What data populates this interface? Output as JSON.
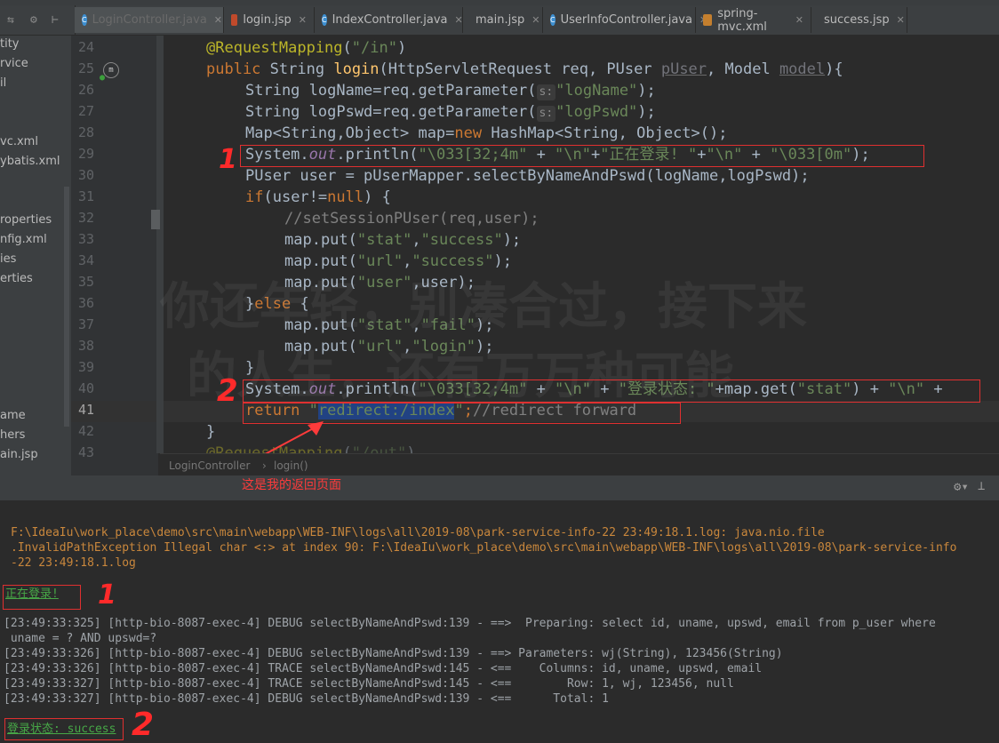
{
  "tabs": [
    {
      "label": "LoginController.java",
      "type": "java",
      "active": true
    },
    {
      "label": "login.jsp",
      "type": "jsp"
    },
    {
      "label": "IndexController.java",
      "type": "java"
    },
    {
      "label": "main.jsp",
      "type": "jsp"
    },
    {
      "label": "UserInfoController.java",
      "type": "java"
    },
    {
      "label": "spring-mvc.xml",
      "type": "xml"
    },
    {
      "label": "success.jsp",
      "type": "jsp"
    }
  ],
  "project_items": [
    "tity",
    "rvice",
    "il",
    "",
    "",
    "vc.xml",
    "ybatis.xml",
    "",
    "",
    "roperties",
    "nfig.xml",
    "ies",
    "erties",
    "",
    "",
    "",
    "",
    "",
    "",
    "ame",
    "hers",
    "ain.jsp"
  ],
  "line_numbers": [
    "24",
    "25",
    "26",
    "27",
    "28",
    "29",
    "30",
    "31",
    "32",
    "33",
    "34",
    "35",
    "36",
    "37",
    "38",
    "39",
    "40",
    "41",
    "42",
    "43"
  ],
  "code": {
    "l24_annot": "@RequestMapping",
    "l24_str": "\"/in\"",
    "l25_kw1": "public",
    "l25_type": "String",
    "l25_fn": "login",
    "l25_p1": "HttpServletRequest req, PUser",
    "l25_p2": "pUser",
    "l25_p3": ", Model",
    "l25_p4": "model",
    "l25_end": "){",
    "l26_a": "String logName=req.getParameter(",
    "l26_hint": "s:",
    "l26_str": "\"logName\"",
    "l26_end": ");",
    "l27_a": "String logPswd=req.getParameter(",
    "l27_hint": "s:",
    "l27_str": "\"logPswd\"",
    "l27_end": ");",
    "l28_a": "Map<String,Object> map=",
    "l28_kw": "new",
    "l28_b": "HashMap<String, Object>();",
    "l29_a": "System.",
    "l29_out": "out",
    "l29_b": ".println(",
    "l29_s1": "\"\\033[32;4m\"",
    "l29_c": " + ",
    "l29_s2": "\"\\n\"",
    "l29_d": "+",
    "l29_s3": "\"正在登录! \"",
    "l29_e": "+",
    "l29_s4": "\"\\n\"",
    "l29_f": " + ",
    "l29_s5": "\"\\033[0m\"",
    "l29_end": ");",
    "l30": "PUser user = pUserMapper.selectByNameAndPswd(logName,logPswd);",
    "l31_kw": "if",
    "l31_a": "(user!=",
    "l31_null": "null",
    "l31_b": ") {",
    "l32": "//setSessionPUser(req,user);",
    "l33_a": "map.put(",
    "l33_s1": "\"stat\"",
    "l33_c": ",",
    "l33_s2": "\"success\"",
    "l33_end": ");",
    "l34_a": "map.put(",
    "l34_s1": "\"url\"",
    "l34_c": ",",
    "l34_s2": "\"success\"",
    "l34_end": ");",
    "l35_a": "map.put(",
    "l35_s1": "\"user\"",
    "l35_end": ",user);",
    "l36_a": "}",
    "l36_kw": "else",
    "l36_b": " {",
    "l37_a": "map.put(",
    "l37_s1": "\"stat\"",
    "l37_c": ",",
    "l37_s2": "\"fail\"",
    "l37_end": ");",
    "l38_a": "map.put(",
    "l38_s1": "\"url\"",
    "l38_c": ",",
    "l38_s2": "\"login\"",
    "l38_end": ");",
    "l39": "}",
    "l40_a": "System.",
    "l40_out": "out",
    "l40_b": ".println(",
    "l40_s1": "\"\\033[32;4m\"",
    "l40_c": " + ",
    "l40_s2": "\"\\n\"",
    "l40_d": " + ",
    "l40_s3": "\"登录状态: \"",
    "l40_e": "+map.get(",
    "l40_s4": "\"stat\"",
    "l40_f": ") + ",
    "l40_s5": "\"\\n\"",
    "l40_g": " +",
    "l41_kw": "return",
    "l41_q1": " \"",
    "l41_sel": "redirect:/index",
    "l41_q2": "\"",
    "l41_semi": ";",
    "l41_cm": "//redirect forward",
    "l42": "}",
    "l43_annot": "@RequestMapping",
    "l43_str": "\"/out\""
  },
  "breadcrumb": {
    "class": "LoginController",
    "sep": "›",
    "method": "login()"
  },
  "callout": "这是我的返回页面",
  "run_label": "t",
  "console": {
    "err1": "F:\\IdeaIu\\work_place\\demo\\src\\main\\webapp\\WEB-INF\\logs\\all\\2019-08\\park-service-info-22 23:49:18.1.log: java.nio.file",
    "err2": ".InvalidPathException Illegal char <:> at index 90: F:\\IdeaIu\\work_place\\demo\\src\\main\\webapp\\WEB-INF\\logs\\all\\2019-08\\park-service-info",
    "err3": "-22 23:49:18.1.log",
    "logging": "正在登录!",
    "d1": "[23:49:33:325] [http-bio-8087-exec-4] DEBUG selectByNameAndPswd:139 - ==>  Preparing: select id, uname, upswd, email from p_user where",
    "d2": " uname = ? AND upswd=?",
    "d3": "[23:49:33:326] [http-bio-8087-exec-4] DEBUG selectByNameAndPswd:139 - ==> Parameters: wj(String), 123456(String)",
    "d4": "[23:49:33:326] [http-bio-8087-exec-4] TRACE selectByNameAndPswd:145 - <==    Columns: id, uname, upswd, email",
    "d5": "[23:49:33:327] [http-bio-8087-exec-4] TRACE selectByNameAndPswd:145 - <==        Row: 1, wj, 123456, null",
    "d6": "[23:49:33:327] [http-bio-8087-exec-4] DEBUG selectByNameAndPswd:139 - <==      Total: 1",
    "status": "登录状态: success"
  },
  "annotations": {
    "one": "1",
    "two": "2"
  },
  "watermark": {
    "line1": "你还年轻，别凑合过，接下来",
    "line2": "的人生，还有万万种可能"
  },
  "colors": {
    "keyword": "#cc7832",
    "string": "#6a8759",
    "annotation_box": "#e03030"
  }
}
